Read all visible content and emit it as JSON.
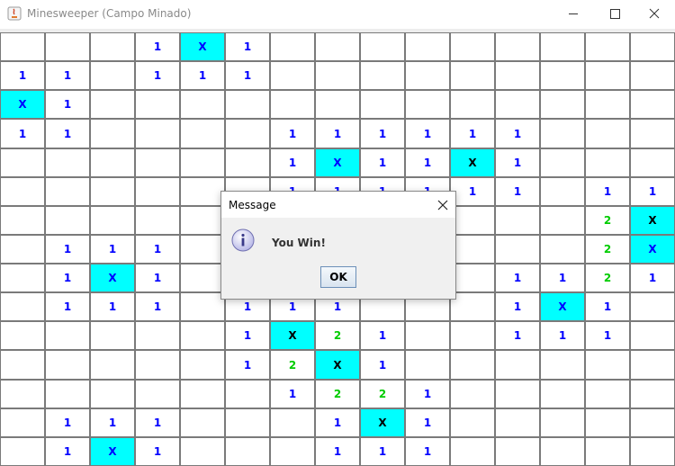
{
  "window": {
    "title": "Minesweeper (Campo Minado)"
  },
  "board": {
    "rows": 15,
    "cols": 15,
    "mine_label": "X",
    "mine_color": "#00ffff",
    "number_colors": {
      "1": "#0000ff",
      "2": "#00cc00",
      "X": "#0000ff"
    },
    "grid": [
      [
        "",
        "",
        "",
        "1",
        "X",
        "1",
        "",
        "",
        "",
        "",
        "",
        "",
        "",
        "",
        ""
      ],
      [
        "1",
        "1",
        "",
        "1",
        "1",
        "1",
        "",
        "",
        "",
        "",
        "",
        "",
        "",
        "",
        ""
      ],
      [
        "X",
        "1",
        "",
        "",
        "",
        "",
        "",
        "",
        "",
        "",
        "",
        "",
        "",
        "",
        ""
      ],
      [
        "1",
        "1",
        "",
        "",
        "",
        "",
        "1",
        "1",
        "1",
        "1",
        "1",
        "1",
        "",
        "",
        ""
      ],
      [
        "",
        "",
        "",
        "",
        "",
        "",
        "1",
        "X",
        "1",
        "1",
        "X",
        "1",
        "",
        "",
        ""
      ],
      [
        "",
        "",
        "",
        "",
        "",
        "",
        "1",
        "1",
        "1",
        "1",
        "1",
        "1",
        "",
        "1",
        "1"
      ],
      [
        "",
        "",
        "",
        "",
        "",
        "",
        "",
        "",
        "",
        "",
        "",
        "",
        "",
        "2",
        "X"
      ],
      [
        "",
        "1",
        "1",
        "1",
        "",
        "",
        "",
        "",
        "",
        "",
        "",
        "",
        "",
        "2",
        "X"
      ],
      [
        "",
        "1",
        "X",
        "1",
        "",
        "",
        "",
        "",
        "",
        "",
        "",
        "1",
        "1",
        "2",
        "1"
      ],
      [
        "",
        "1",
        "1",
        "1",
        "",
        "1",
        "1",
        "1",
        "",
        "",
        "",
        "1",
        "X",
        "1",
        ""
      ],
      [
        "",
        "",
        "",
        "",
        "",
        "1",
        "X",
        "2",
        "1",
        "",
        "",
        "1",
        "1",
        "1",
        ""
      ],
      [
        "",
        "",
        "",
        "",
        "",
        "1",
        "2",
        "X",
        "1",
        "",
        "",
        "",
        "",
        "",
        ""
      ],
      [
        "",
        "",
        "",
        "",
        "",
        "",
        "1",
        "2",
        "2",
        "1",
        "",
        "",
        "",
        "",
        ""
      ],
      [
        "",
        "1",
        "1",
        "1",
        "",
        "",
        "",
        "1",
        "X",
        "1",
        "",
        "",
        "",
        "",
        ""
      ],
      [
        "",
        "1",
        "X",
        "1",
        "",
        "",
        "",
        "1",
        "1",
        "1",
        "",
        "",
        "",
        "",
        ""
      ]
    ],
    "black_mines": [
      [
        4,
        10
      ],
      [
        6,
        14
      ],
      [
        10,
        6
      ],
      [
        11,
        7
      ],
      [
        13,
        8
      ]
    ]
  },
  "dialog": {
    "title": "Message",
    "message": "You Win!",
    "ok_label": "OK",
    "icon": "info-icon"
  }
}
